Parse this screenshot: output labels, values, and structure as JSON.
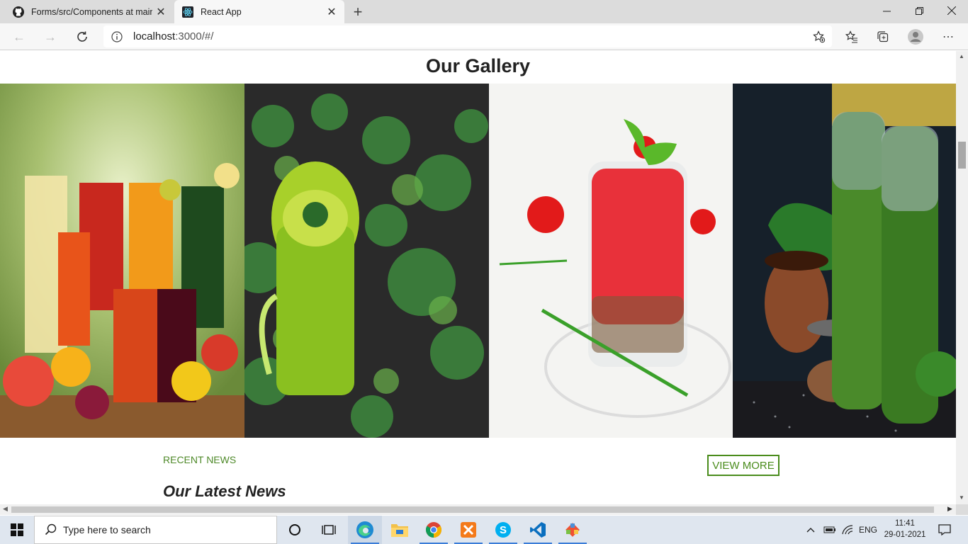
{
  "browser": {
    "tabs": [
      {
        "title": "Forms/src/Components at main ·",
        "icon": "github-icon",
        "active": false
      },
      {
        "title": "React App",
        "icon": "react-icon",
        "active": true
      }
    ],
    "address": {
      "host": "localhost",
      "path": ":3000/#/"
    }
  },
  "page": {
    "gallery_title": "Our Gallery",
    "gallery_images": [
      {
        "name": "fruit-juices-image",
        "desc": ""
      },
      {
        "name": "green-smoothie-image",
        "desc": ""
      },
      {
        "name": "tomato-juice-image",
        "desc": ""
      },
      {
        "name": "spinach-smoothie-image",
        "desc": ""
      }
    ],
    "recent_news_label": "RECENT NEWS",
    "view_more_label": "VIEW MORE",
    "latest_news_heading": "Our Latest News"
  },
  "taskbar": {
    "search_placeholder": "Type here to search",
    "language": "ENG",
    "time": "11:41",
    "date": "29-01-2021"
  },
  "colors": {
    "accent_green": "#4a8c1c",
    "taskbar_bg": "#dfe6ef"
  }
}
